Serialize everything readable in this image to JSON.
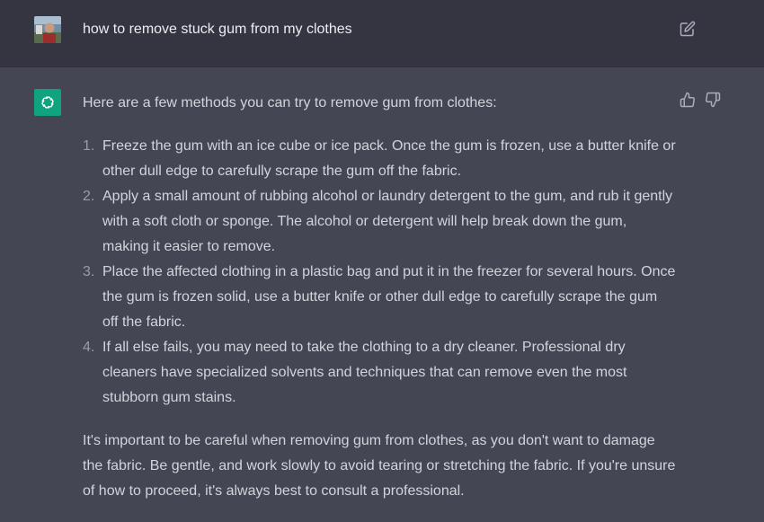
{
  "user_message": {
    "text": "how to remove stuck gum from my clothes",
    "avatar_icon": "user-avatar",
    "edit_icon": "edit-icon"
  },
  "assistant_message": {
    "avatar_icon": "openai-logo-icon",
    "avatar_color": "#10a37f",
    "intro": "Here are a few methods you can try to remove gum from clothes:",
    "steps": [
      {
        "number": "1.",
        "text": "Freeze the gum with an ice cube or ice pack. Once the gum is frozen, use a butter knife or other dull edge to carefully scrape the gum off the fabric."
      },
      {
        "number": "2.",
        "text": "Apply a small amount of rubbing alcohol or laundry detergent to the gum, and rub it gently with a soft cloth or sponge. The alcohol or detergent will help break down the gum, making it easier to remove."
      },
      {
        "number": "3.",
        "text": "Place the affected clothing in a plastic bag and put it in the freezer for several hours. Once the gum is frozen solid, use a butter knife or other dull edge to carefully scrape the gum off the fabric."
      },
      {
        "number": "4.",
        "text": "If all else fails, you may need to take the clothing to a dry cleaner. Professional dry cleaners have specialized solvents and techniques that can remove even the most stubborn gum stains."
      }
    ],
    "conclusion": "It's important to be careful when removing gum from clothes, as you don't want to damage the fabric. Be gentle, and work slowly to avoid tearing or stretching the fabric. If you're unsure of how to proceed, it's always best to consult a professional.",
    "feedback_icons": [
      "thumbs-up-icon",
      "thumbs-down-icon"
    ]
  },
  "colors": {
    "user_row_bg": "#343541",
    "assistant_row_bg": "#444654",
    "text": "#d1d5db",
    "accent": "#10a37f"
  }
}
